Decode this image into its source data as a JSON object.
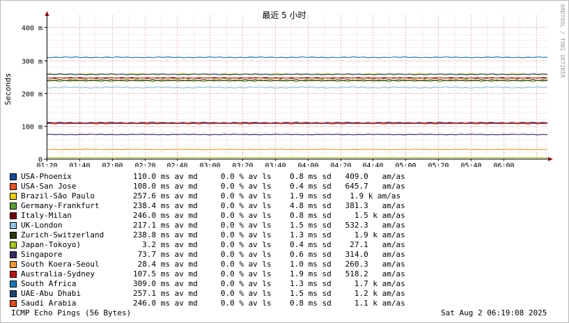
{
  "colors": {
    "grid": "#f4a0a0",
    "axis": "#000000",
    "arrow": "#a00000",
    "watermark": "#9a9a9a"
  },
  "watermark": "RRDTOOL / TOBI OETIKER",
  "chart_data": {
    "type": "line",
    "title": "最近 5 小时",
    "ylabel": "Seconds",
    "ylim": [
      0,
      0.42
    ],
    "yticks": [
      {
        "value": 0,
        "label": "0"
      },
      {
        "value": 0.1,
        "label": "100 m"
      },
      {
        "value": 0.2,
        "label": "200 m"
      },
      {
        "value": 0.3,
        "label": "300 m"
      },
      {
        "value": 0.4,
        "label": "400 m"
      }
    ],
    "xlim": [
      "01:20",
      "06:27"
    ],
    "xticks": [
      "01:20",
      "01:40",
      "02:00",
      "02:20",
      "02:40",
      "03:00",
      "03:20",
      "03:40",
      "04:00",
      "04:20",
      "04:40",
      "05:00",
      "05:20",
      "05:40",
      "06:00"
    ],
    "grid": true,
    "series": [
      {
        "name": "USA-Phoenix",
        "color": "#0e4ca0",
        "value": 0.11,
        "jitter": 0.0015
      },
      {
        "name": "USA-San Jose",
        "color": "#ee5020",
        "value": 0.108,
        "jitter": 0.0015
      },
      {
        "name": "Brazil-São Paulo",
        "color": "#f4d200",
        "value": 0.2576,
        "jitter": 0.002
      },
      {
        "name": "Germany-Frankfurt",
        "color": "#5aa02c",
        "value": 0.2384,
        "jitter": 0.004
      },
      {
        "name": "Italy-Milan",
        "color": "#7a0000",
        "value": 0.246,
        "jitter": 0.0015
      },
      {
        "name": "UK-London",
        "color": "#8cc4ec",
        "value": 0.2171,
        "jitter": 0.002
      },
      {
        "name": "Zurich-Switzerland",
        "color": "#2c3a06",
        "value": 0.2388,
        "jitter": 0.002
      },
      {
        "name": "Japan-Tokoyo)",
        "color": "#a6c91a",
        "value": 0.0032,
        "jitter": 0.0005
      },
      {
        "name": "Singapore",
        "color": "#3a2a6c",
        "value": 0.0737,
        "jitter": 0.001
      },
      {
        "name": "South Koera-Seoul",
        "color": "#f49a2c",
        "value": 0.0284,
        "jitter": 0.001
      },
      {
        "name": "Australia-Sydney",
        "color": "#c41010",
        "value": 0.1075,
        "jitter": 0.0015
      },
      {
        "name": "South Africa",
        "color": "#1a7ac4",
        "value": 0.309,
        "jitter": 0.0015
      },
      {
        "name": "UAE-Abu Dhabi",
        "color": "#1c4470",
        "value": 0.2571,
        "jitter": 0.0015
      },
      {
        "name": "Saudi Arabia",
        "color": "#e44a1a",
        "value": 0.246,
        "jitter": 0.0015
      }
    ]
  },
  "legend": [
    {
      "name": "USA-Phoenix",
      "stats": "110.0 ms av md     0.0 % av ls    0.8 ms sd   409.0   am/as"
    },
    {
      "name": "USA-San Jose",
      "stats": "108.0 ms av md     0.0 % av ls    0.4 ms sd   645.7   am/as"
    },
    {
      "name": "Brazil-São Paulo",
      "stats": "257.6 ms av md     0.0 % av ls    1.9 ms sd    1.9 k am/as"
    },
    {
      "name": "Germany-Frankfurt",
      "stats": "238.4 ms av md     0.0 % av ls    4.8 ms sd   381.3   am/as"
    },
    {
      "name": "Italy-Milan",
      "stats": "246.0 ms av md     0.0 % av ls    0.8 ms sd     1.5 k am/as"
    },
    {
      "name": "UK-London",
      "stats": "217.1 ms av md     0.0 % av ls    1.5 ms sd   532.3   am/as"
    },
    {
      "name": "Zurich-Switzerland",
      "stats": "238.8 ms av md     0.0 % av ls    1.3 ms sd     1.9 k am/as"
    },
    {
      "name": "Japan-Tokoyo)",
      "stats": "  3.2 ms av md     0.0 % av ls    0.4 ms sd    27.1   am/as"
    },
    {
      "name": "Singapore",
      "stats": " 73.7 ms av md     0.0 % av ls    0.6 ms sd   314.0   am/as"
    },
    {
      "name": "South Koera-Seoul",
      "stats": " 28.4 ms av md     0.0 % av ls    1.0 ms sd   260.3   am/as"
    },
    {
      "name": "Australia-Sydney",
      "stats": "107.5 ms av md     0.0 % av ls    1.9 ms sd   518.2   am/as"
    },
    {
      "name": "South Africa",
      "stats": "309.0 ms av md     0.0 % av ls    1.3 ms sd     1.7 k am/as"
    },
    {
      "name": "UAE-Abu Dhabi",
      "stats": "257.1 ms av md     0.0 % av ls    1.5 ms sd     1.2 k am/as"
    },
    {
      "name": "Saudi Arabia",
      "stats": "246.0 ms av md     0.0 % av ls    0.8 ms sd     1.1 k am/as"
    }
  ],
  "footer": {
    "title": "ICMP Echo Pings (56 Bytes)",
    "date": "Sat Aug  2 06:19:08 2025"
  }
}
